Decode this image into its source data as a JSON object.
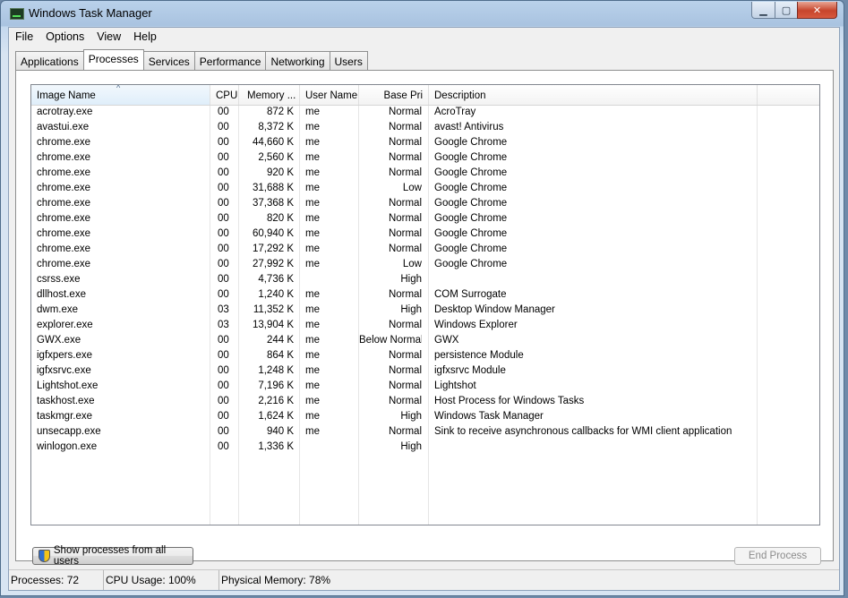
{
  "window": {
    "title": "Windows Task Manager"
  },
  "menu": [
    "File",
    "Options",
    "View",
    "Help"
  ],
  "tabs": [
    "Applications",
    "Processes",
    "Services",
    "Performance",
    "Networking",
    "Users"
  ],
  "active_tab": "Processes",
  "columns": {
    "image_name": "Image Name",
    "cpu": "CPU",
    "memory": "Memory ...",
    "user_name": "User Name",
    "base_pri": "Base Pri",
    "description": "Description"
  },
  "rows": [
    {
      "name": "acrotray.exe",
      "cpu": "00",
      "mem": "872 K",
      "user": "me",
      "pri": "Normal",
      "desc": "AcroTray"
    },
    {
      "name": "avastui.exe",
      "cpu": "00",
      "mem": "8,372 K",
      "user": "me",
      "pri": "Normal",
      "desc": "avast! Antivirus"
    },
    {
      "name": "chrome.exe",
      "cpu": "00",
      "mem": "44,660 K",
      "user": "me",
      "pri": "Normal",
      "desc": "Google Chrome"
    },
    {
      "name": "chrome.exe",
      "cpu": "00",
      "mem": "2,560 K",
      "user": "me",
      "pri": "Normal",
      "desc": "Google Chrome"
    },
    {
      "name": "chrome.exe",
      "cpu": "00",
      "mem": "920 K",
      "user": "me",
      "pri": "Normal",
      "desc": "Google Chrome"
    },
    {
      "name": "chrome.exe",
      "cpu": "00",
      "mem": "31,688 K",
      "user": "me",
      "pri": "Low",
      "desc": "Google Chrome"
    },
    {
      "name": "chrome.exe",
      "cpu": "00",
      "mem": "37,368 K",
      "user": "me",
      "pri": "Normal",
      "desc": "Google Chrome"
    },
    {
      "name": "chrome.exe",
      "cpu": "00",
      "mem": "820 K",
      "user": "me",
      "pri": "Normal",
      "desc": "Google Chrome"
    },
    {
      "name": "chrome.exe",
      "cpu": "00",
      "mem": "60,940 K",
      "user": "me",
      "pri": "Normal",
      "desc": "Google Chrome"
    },
    {
      "name": "chrome.exe",
      "cpu": "00",
      "mem": "17,292 K",
      "user": "me",
      "pri": "Normal",
      "desc": "Google Chrome"
    },
    {
      "name": "chrome.exe",
      "cpu": "00",
      "mem": "27,992 K",
      "user": "me",
      "pri": "Low",
      "desc": "Google Chrome"
    },
    {
      "name": "csrss.exe",
      "cpu": "00",
      "mem": "4,736 K",
      "user": "",
      "pri": "High",
      "desc": ""
    },
    {
      "name": "dllhost.exe",
      "cpu": "00",
      "mem": "1,240 K",
      "user": "me",
      "pri": "Normal",
      "desc": "COM Surrogate"
    },
    {
      "name": "dwm.exe",
      "cpu": "03",
      "mem": "11,352 K",
      "user": "me",
      "pri": "High",
      "desc": "Desktop Window Manager"
    },
    {
      "name": "explorer.exe",
      "cpu": "03",
      "mem": "13,904 K",
      "user": "me",
      "pri": "Normal",
      "desc": "Windows Explorer"
    },
    {
      "name": "GWX.exe",
      "cpu": "00",
      "mem": "244 K",
      "user": "me",
      "pri": "Below Normal",
      "desc": "GWX"
    },
    {
      "name": "igfxpers.exe",
      "cpu": "00",
      "mem": "864 K",
      "user": "me",
      "pri": "Normal",
      "desc": "persistence Module"
    },
    {
      "name": "igfxsrvc.exe",
      "cpu": "00",
      "mem": "1,248 K",
      "user": "me",
      "pri": "Normal",
      "desc": "igfxsrvc Module"
    },
    {
      "name": "Lightshot.exe",
      "cpu": "00",
      "mem": "7,196 K",
      "user": "me",
      "pri": "Normal",
      "desc": "Lightshot"
    },
    {
      "name": "taskhost.exe",
      "cpu": "00",
      "mem": "2,216 K",
      "user": "me",
      "pri": "Normal",
      "desc": "Host Process for Windows Tasks"
    },
    {
      "name": "taskmgr.exe",
      "cpu": "00",
      "mem": "1,624 K",
      "user": "me",
      "pri": "High",
      "desc": "Windows Task Manager"
    },
    {
      "name": "unsecapp.exe",
      "cpu": "00",
      "mem": "940 K",
      "user": "me",
      "pri": "Normal",
      "desc": "Sink to receive asynchronous callbacks for WMI client application"
    },
    {
      "name": "winlogon.exe",
      "cpu": "00",
      "mem": "1,336 K",
      "user": "",
      "pri": "High",
      "desc": ""
    }
  ],
  "buttons": {
    "show_all": "Show processes from all users",
    "end_process": "End Process"
  },
  "status": {
    "processes": "Processes: 72",
    "cpu": "CPU Usage: 100%",
    "memory": "Physical Memory: 78%"
  }
}
